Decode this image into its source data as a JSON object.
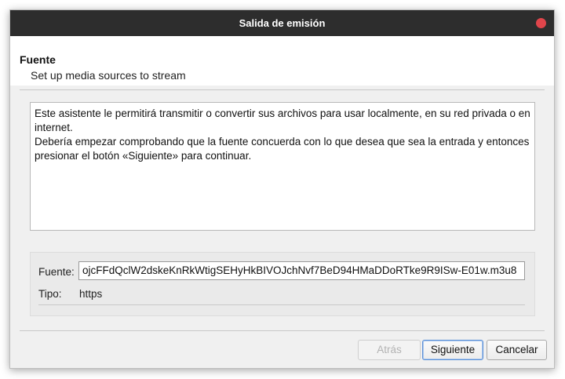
{
  "window": {
    "title": "Salida de emisión"
  },
  "header": {
    "title": "Fuente",
    "subtitle": "Set up media sources to stream"
  },
  "description": {
    "line1": "Este asistente le permitirá transmitir o convertir sus archivos para usar localmente, en su red privada o en internet.",
    "line2": "Debería empezar comprobando que la fuente concuerda con lo que desea que sea la entrada y entonces presionar el botón «Siguiente» para continuar."
  },
  "source": {
    "label": "Fuente:",
    "value": "ojcFFdQclW2dskeKnRkWtigSEHyHkBIVOJchNvf7BeD94HMaDDoRTke9R9ISw-E01w.m3u8",
    "type_label": "Tipo:",
    "type_value": "https"
  },
  "buttons": {
    "back": "Atrás",
    "next": "Siguiente",
    "cancel": "Cancelar"
  },
  "colors": {
    "titlebar": "#2d2d2d",
    "close": "#e0454b",
    "accent": "#5b8fd6"
  }
}
